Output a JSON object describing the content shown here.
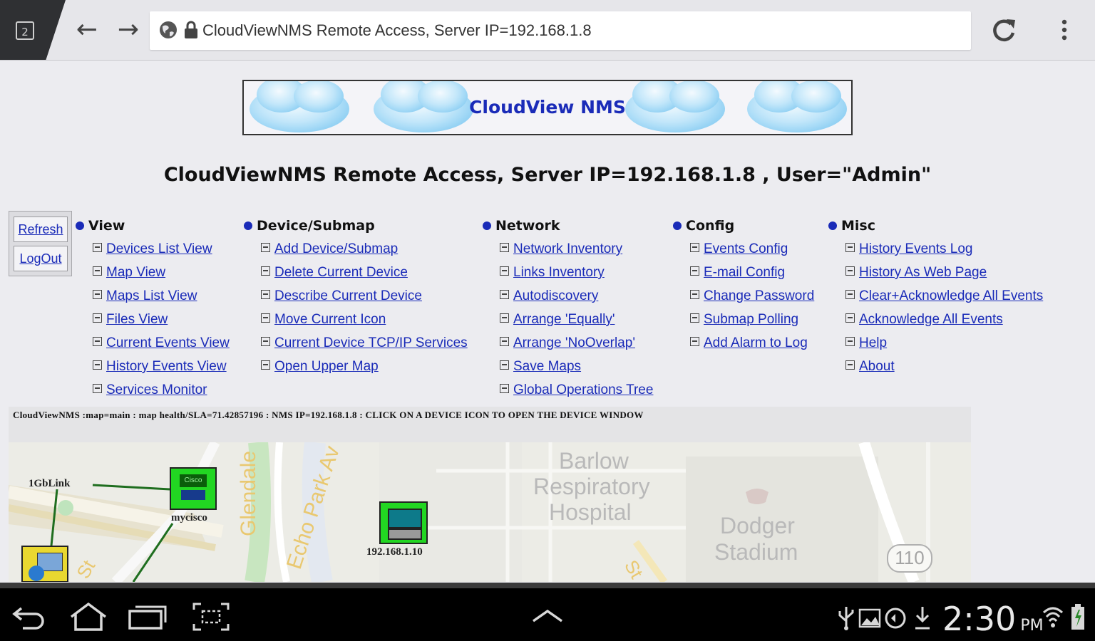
{
  "browser": {
    "tab_count": "2",
    "url": "CloudViewNMS Remote Access, Server IP=192.168.1.8"
  },
  "banner": {
    "title": "CloudView NMS"
  },
  "page_title": "CloudViewNMS Remote Access, Server IP=192.168.1.8 , User=\"Admin\"",
  "side_buttons": {
    "refresh": "Refresh",
    "logout": "LogOut"
  },
  "menus": [
    {
      "heading": "View",
      "items": [
        "Devices List View",
        "Map View",
        "Maps List View",
        "Files View",
        "Current Events View",
        "History Events View",
        "Services Monitor"
      ]
    },
    {
      "heading": "Device/Submap",
      "items": [
        "Add Device/Submap",
        "Delete Current Device",
        "Describe Current Device",
        "Move Current Icon",
        "Current Device TCP/IP Services",
        "Open Upper Map"
      ]
    },
    {
      "heading": "Network",
      "items": [
        "Network Inventory",
        "Links Inventory",
        "Autodiscovery",
        "Arrange 'Equally'",
        "Arrange 'NoOverlap'",
        "Save Maps",
        "Global Operations Tree"
      ]
    },
    {
      "heading": "Config",
      "items": [
        "Events Config",
        "E-mail Config",
        "Change Password",
        "Submap Polling",
        "Add Alarm to Log"
      ]
    },
    {
      "heading": "Misc",
      "items": [
        "History Events Log",
        "History As Web Page",
        "Clear+Acknowledge All Events",
        "Acknowledge All Events",
        "Help",
        "About"
      ]
    }
  ],
  "status_line": "CloudViewNMS :map=main : map health/SLA=71.42857196 : NMS IP=192.168.1.8 : CLICK ON A DEVICE ICON TO OPEN THE DEVICE WINDOW",
  "map": {
    "place_labels": {
      "barlow_1": "Barlow",
      "barlow_2": "Respiratory",
      "barlow_3": "Hospital",
      "dodger_1": "Dodger",
      "dodger_2": "Stadium"
    },
    "street_labels": {
      "glendale": "Glendale",
      "echo_park": "Echo Park Av",
      "st_left": "St",
      "st_right": "St"
    },
    "highway": "110",
    "nodes": {
      "link": "1GbLink",
      "cisco": "mycisco",
      "ip": "192.168.1.10",
      "cisco_icon_text": "Cisco"
    }
  },
  "system_bar": {
    "time": "2:30",
    "ampm": "PM"
  }
}
